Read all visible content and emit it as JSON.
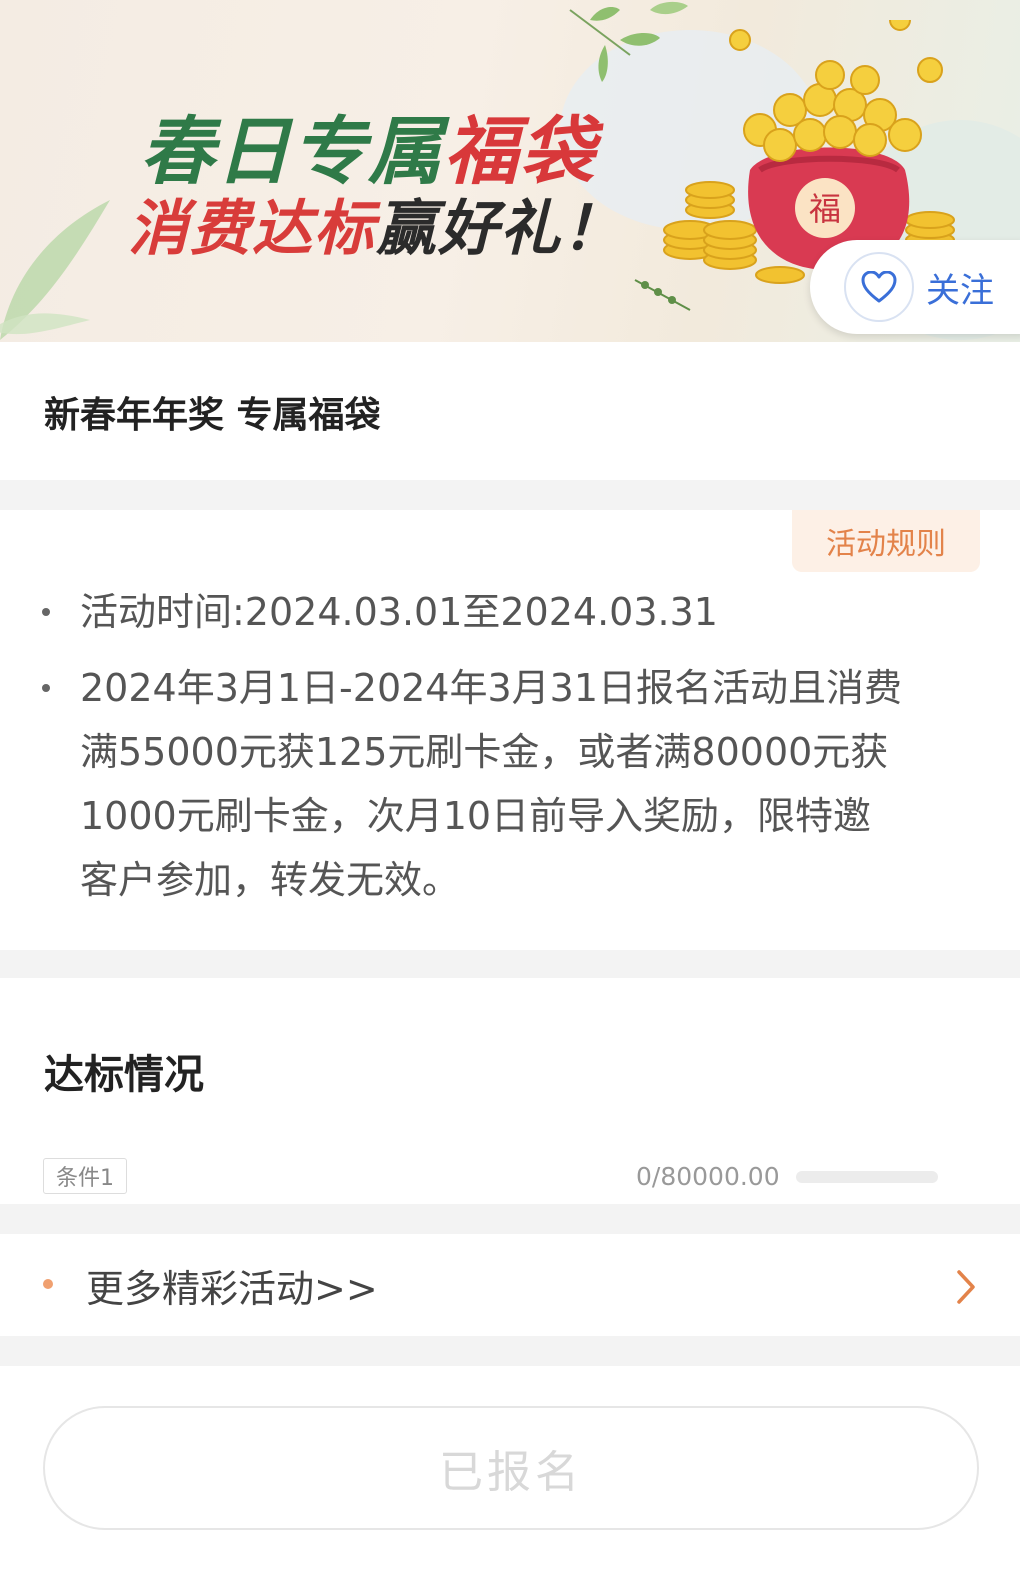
{
  "banner": {
    "line1_green": "春日专属",
    "line1_red": "福袋",
    "line2_red": "消费达标",
    "line2_dark": "赢好礼！",
    "bag_char": "福"
  },
  "follow": {
    "label": "关注",
    "icon": "heart-icon"
  },
  "page_title": "新春年年奖 专属福袋",
  "rules": {
    "tag": "活动规则",
    "items": [
      {
        "lines": [
          "活动时间:2024.03.01至2024.03.31"
        ]
      },
      {
        "lines": [
          "2024年3月1日-2024年3月31日报名活动且消费",
          "满55000元获125元刷卡金，或者满80000元获",
          "1000元刷卡金，次月10日前导入奖励，限特邀",
          "客户参加，转发无效。"
        ]
      }
    ]
  },
  "status": {
    "title": "达标情况",
    "condition_label": "条件1",
    "progress_text": "0/80000.00",
    "progress_fraction": 0
  },
  "more": {
    "label": "更多精彩活动>>",
    "icon": "chevron-right-icon"
  },
  "signup": {
    "label": "已报名"
  },
  "colors": {
    "accent": "#e3834a",
    "brand_green": "#2f7a48",
    "brand_red": "#d8383a",
    "link_blue": "#3a6fd8"
  }
}
